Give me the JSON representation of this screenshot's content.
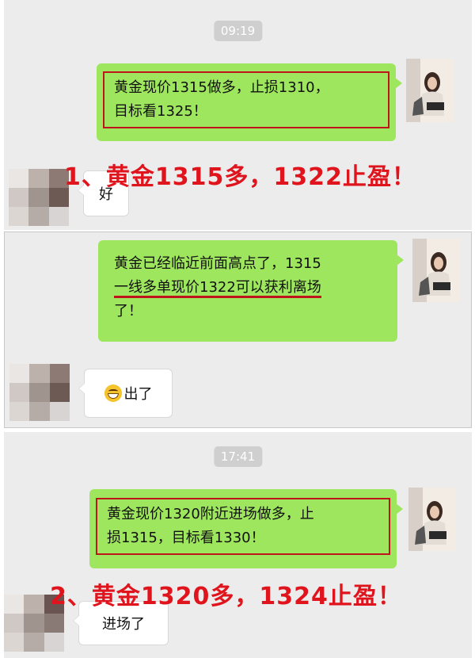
{
  "section1": {
    "time": "09:19",
    "msg_line1": "黄金现价1315做多，止损1310，",
    "msg_line2": "目标看1325！",
    "reply": "好",
    "annotation": "1、黄金1315多，1322止盈！"
  },
  "section2": {
    "msg_line1": "黄金已经临近前面高点了，1315",
    "msg_line2": "一线多单现价1322可以获利离场",
    "msg_line3": "了！",
    "reply": "出了",
    "reply_emoji": "grin-emoji"
  },
  "section3": {
    "time": "17:41",
    "msg_line1": "黄金现价1320附近进场做多，止",
    "msg_line2": "损1315，目标看1330！",
    "reply": "进场了",
    "annotation": "2、黄金1320多，1324止盈！"
  },
  "colors": {
    "green_bubble": "#9ee65e",
    "annotation_red": "#e0141c",
    "chat_background": "#ececec"
  }
}
